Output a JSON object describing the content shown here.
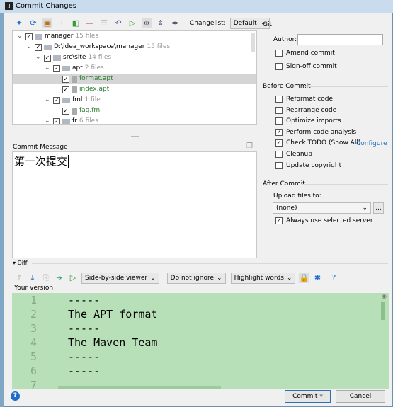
{
  "window": {
    "title": "Commit Changes",
    "app_icon": "IJ"
  },
  "toolbar": {
    "icons": [
      "move-icon",
      "refresh-icon",
      "clipboard-icon",
      "add-icon",
      "merge-icon",
      "remove-icon",
      "group-icon",
      "revert-icon",
      "diff-icon",
      "expand-toggle-icon",
      "expand-all-icon",
      "collapse-all-icon"
    ],
    "changelist_label": "Changelist:",
    "changelist_value": "Default"
  },
  "tree": [
    {
      "name": "manager",
      "count": "15 files",
      "level": 0,
      "type": "module"
    },
    {
      "name": "D:\\idea_workspace\\manager",
      "count": "15 files",
      "level": 1,
      "type": "folder"
    },
    {
      "name": "src\\site",
      "count": "14 files",
      "level": 2,
      "type": "folder"
    },
    {
      "name": "apt",
      "count": "2 files",
      "level": 3,
      "type": "folder"
    },
    {
      "name": "format.apt",
      "count": "",
      "level": 4,
      "type": "file",
      "selected": true
    },
    {
      "name": "index.apt",
      "count": "",
      "level": 4,
      "type": "file"
    },
    {
      "name": "fml",
      "count": "1 file",
      "level": 3,
      "type": "folder"
    },
    {
      "name": "faq.fml",
      "count": "",
      "level": 4,
      "type": "file"
    },
    {
      "name": "fr",
      "count": "6 files",
      "level": 3,
      "type": "folder"
    }
  ],
  "commit_message": {
    "label": "Commit Message",
    "value": "第一次提交"
  },
  "git": {
    "header": "Git",
    "author_label": "Author:",
    "author_value": "",
    "amend": "Amend commit",
    "signoff": "Sign-off commit"
  },
  "before_commit": {
    "header": "Before Commit",
    "items": [
      {
        "label": "Reformat code",
        "checked": false
      },
      {
        "label": "Rearrange code",
        "checked": false
      },
      {
        "label": "Optimize imports",
        "checked": false
      },
      {
        "label": "Perform code analysis",
        "checked": true
      },
      {
        "label": "Check TODO (Show All)",
        "checked": true
      },
      {
        "label": "Cleanup",
        "checked": false
      },
      {
        "label": "Update copyright",
        "checked": false
      }
    ],
    "configure": "Configure"
  },
  "after_commit": {
    "header": "After Commit",
    "upload_label": "Upload files to:",
    "upload_value": "(none)",
    "more": "...",
    "always_use": "Always use selected server"
  },
  "diff": {
    "label": "Diff",
    "viewer": "Side-by-side viewer",
    "ignore": "Do not ignore",
    "highlight": "Highlight words",
    "your_version": "Your version",
    "lines": [
      {
        "n": "1",
        "t": "-----"
      },
      {
        "n": "2",
        "t": "The APT format"
      },
      {
        "n": "3",
        "t": "-----"
      },
      {
        "n": "4",
        "t": "The Maven Team"
      },
      {
        "n": "5",
        "t": "-----"
      },
      {
        "n": "6",
        "t": "-----"
      },
      {
        "n": "7",
        "t": ""
      }
    ]
  },
  "buttons": {
    "commit": "Commit",
    "cancel": "Cancel",
    "help": "?"
  },
  "colors": {
    "diff_added": "#b8e0b8",
    "file_added": "#2e7d32",
    "accent": "#1e6fc9"
  }
}
